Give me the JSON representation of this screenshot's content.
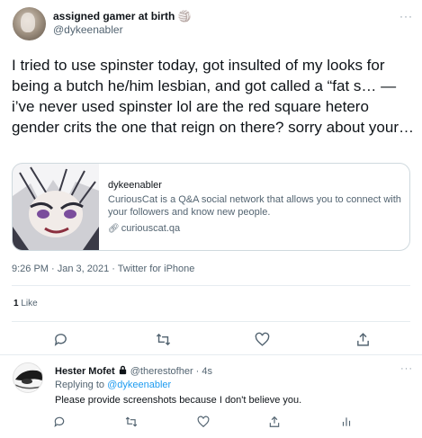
{
  "tweet": {
    "display_name": "assigned gamer at birth 🏐",
    "handle": "@dykeenabler",
    "more": "···",
    "text": "I tried to use spinster today, got insulted of my looks for being a butch he/him lesbian, and got called a “fat s… — i’ve never used spinster lol are the red square hetero gender crits the one that reign on there? sorry about your…",
    "card": {
      "title": "dykeenabler",
      "description": "CuriousCat is a Q&A social network that allows you to connect with your followers and know new people.",
      "link_icon": "link-icon",
      "link": "curiouscat.qa"
    },
    "timestamp": "9:26 PM · Jan 3, 2021 · Twitter for iPhone",
    "like_count": "1",
    "like_label": "Like"
  },
  "actions": [
    "reply-icon",
    "retweet-icon",
    "like-icon",
    "share-icon"
  ],
  "reply": {
    "display_name": "Hester Mofet",
    "lock_icon": "lock-icon",
    "handle": "@therestofher · 4s",
    "replying_prefix": "Replying to",
    "replying_to": "@dykeenabler",
    "text": "Please provide screenshots because I don't believe you.",
    "more": "···",
    "actions": [
      "reply-icon",
      "retweet-icon",
      "like-icon",
      "share-icon",
      "analytics-icon"
    ]
  },
  "colors": {
    "text": "#0f1419",
    "secondary": "#536471",
    "link": "#1d9bf0",
    "border": "#cfd9de"
  }
}
